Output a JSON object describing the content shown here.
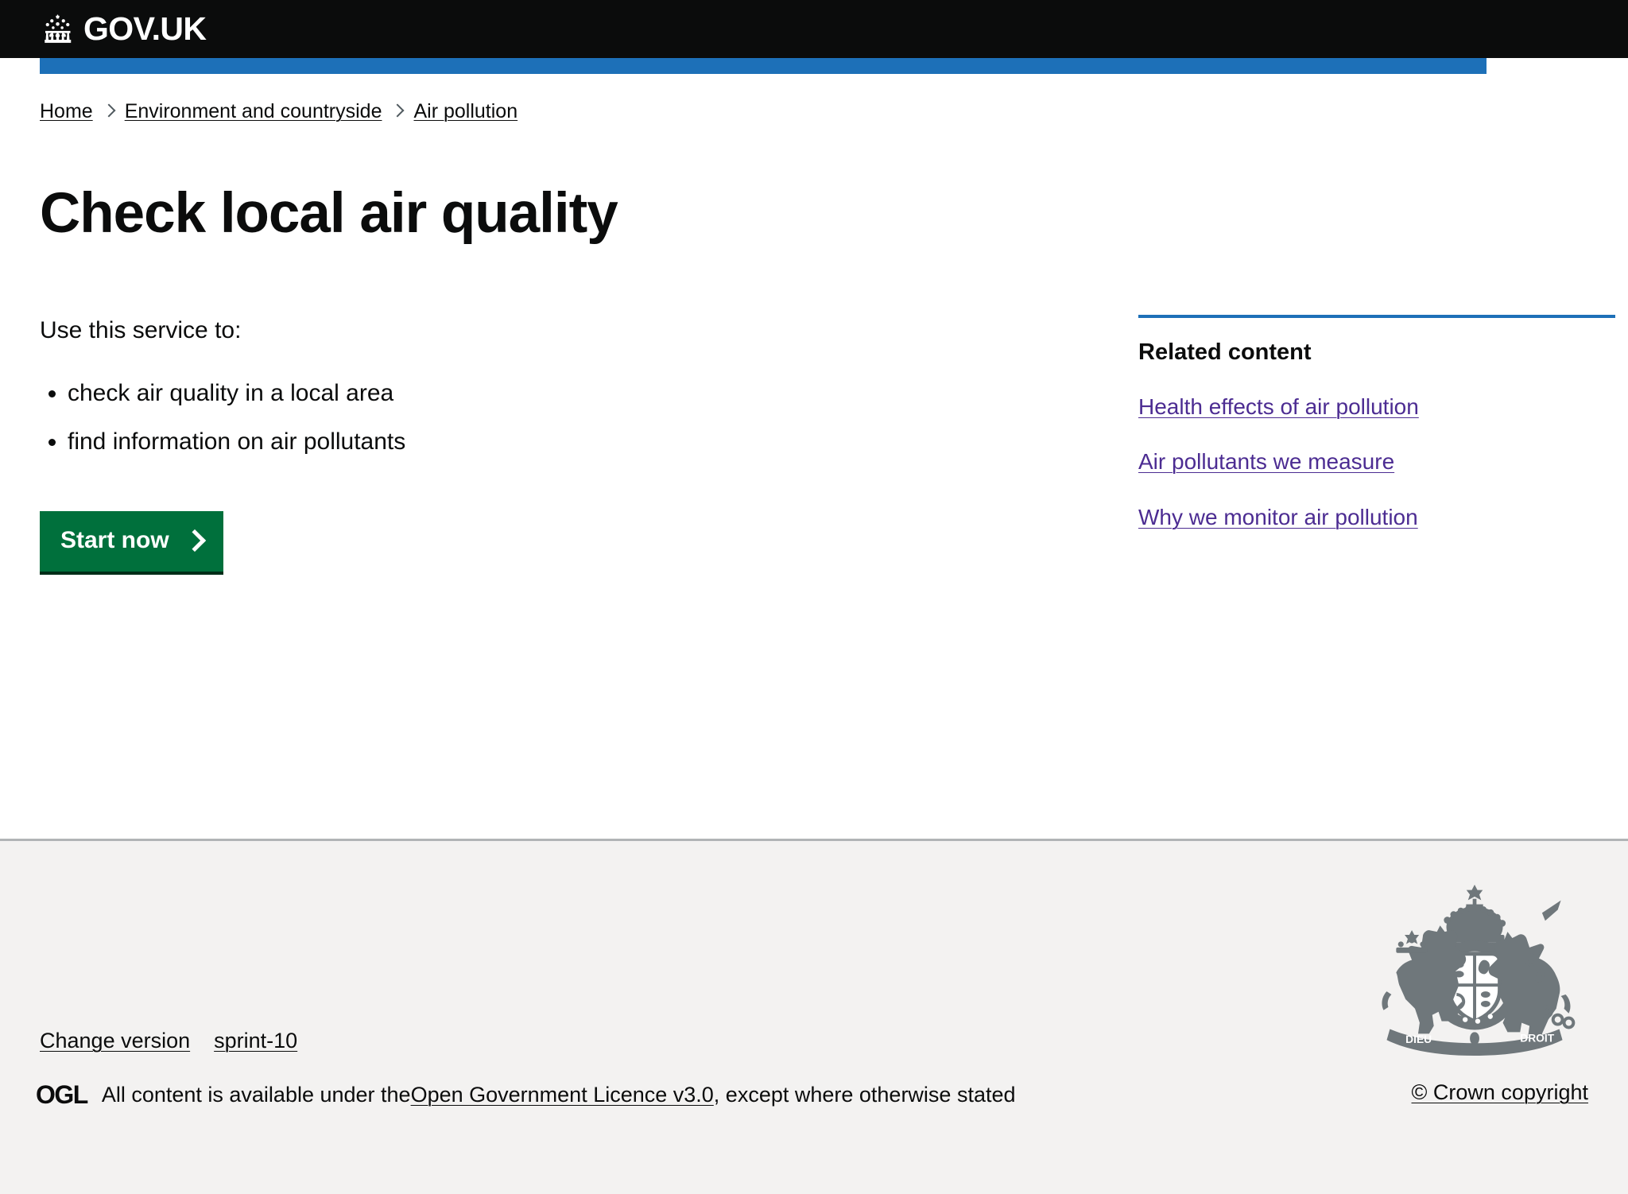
{
  "header": {
    "logo_text": "GOV.UK",
    "crown_icon": "crown-icon",
    "brand_black": "#0b0c0c",
    "accent_blue": "#1d70b8"
  },
  "breadcrumb": {
    "items": [
      {
        "label": "Home"
      },
      {
        "label": "Environment and countryside"
      },
      {
        "label": "Air pollution"
      }
    ],
    "separator_icon": "chevron-right-icon"
  },
  "main": {
    "title": "Check local air quality",
    "lede": "Use this service to:",
    "bullets": [
      "check air quality in a local area",
      "find information on air pollutants"
    ],
    "start_button": {
      "label": "Start now",
      "icon": "chevron-right-icon",
      "background": "#00703c",
      "text_color": "#ffffff"
    }
  },
  "related": {
    "heading": "Related content",
    "rule_color": "#1d70b8",
    "link_color": "#4c2c92",
    "links": [
      {
        "label": "Health effects of air pollution"
      },
      {
        "label": "Air pollutants we measure"
      },
      {
        "label": "Why we monitor air pollution"
      }
    ]
  },
  "footer": {
    "background": "#f3f2f1",
    "border_color": "#b1b4b6",
    "coat_of_arms_icon": "royal-coat-of-arms-icon",
    "change_version_label": "Change version",
    "version_label": "sprint-10",
    "ogl_logo_text": "OGL",
    "licence_prefix": "All content is available under the ",
    "licence_link": "Open Government Licence v3.0",
    "licence_suffix": ", except where otherwise stated",
    "copyright": "© Crown copyright"
  }
}
